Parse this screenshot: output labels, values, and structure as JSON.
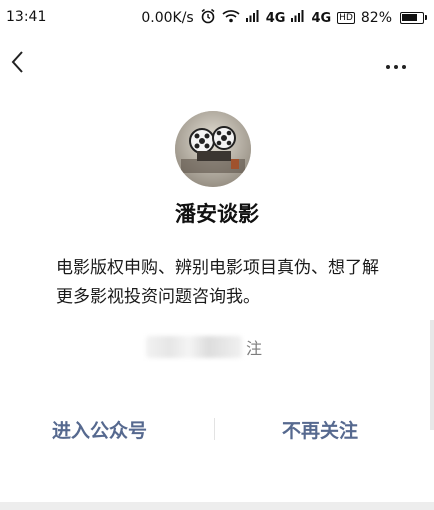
{
  "status_bar": {
    "time": "13:41",
    "net_speed": "0.00K/s",
    "signal_1": "4G",
    "signal_2": "4G",
    "hd_label": "HD",
    "battery_text": "82%",
    "battery_level": 0.82,
    "icons": [
      "alarm-icon",
      "wifi-icon",
      "signal-icon",
      "battery-icon"
    ]
  },
  "nav": {
    "back_icon": "chevron-left-icon",
    "more_icon": "more-dots-icon"
  },
  "profile": {
    "avatar_icon": "avatar-image",
    "name": "潘安谈影",
    "description": "电影版权申购、辨别电影项目真伪、想了解更多影视投资问题咨询我。",
    "follow_note": "注"
  },
  "actions": {
    "enter_label": "进入公众号",
    "unfollow_label": "不再关注"
  },
  "colors": {
    "action_text": "#56698f",
    "meta_text": "#7d7d7d"
  }
}
